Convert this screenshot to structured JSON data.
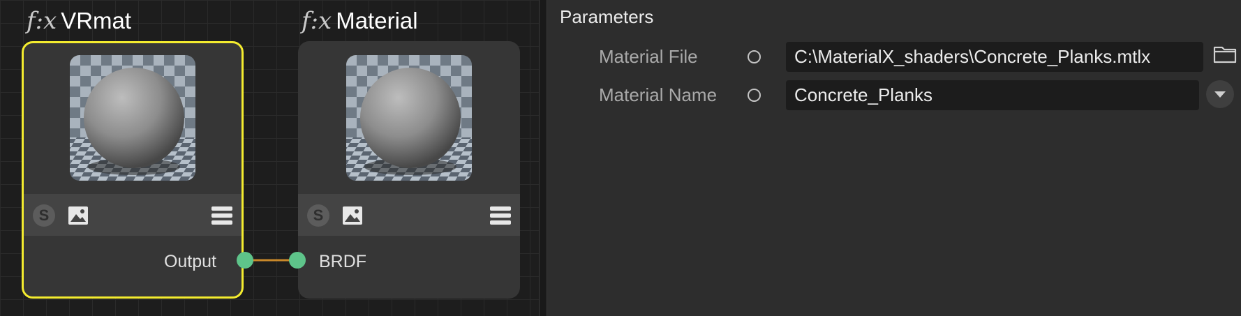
{
  "graph": {
    "nodes": [
      {
        "fx": "f:x",
        "title": "VRmat",
        "output_label": "Output"
      },
      {
        "fx": "f:x",
        "title": "Material",
        "input_label": "BRDF"
      }
    ],
    "toolbar_icons": [
      "shader-s-icon",
      "image-icon",
      "menu-icon"
    ],
    "port_color": "#5ec48a",
    "wire_color": "#c8882a",
    "selection_color": "#f4ec2f"
  },
  "params": {
    "title": "Parameters",
    "rows": [
      {
        "label": "Material File",
        "value": "C:\\MaterialX_shaders\\Concrete_Planks.mtlx",
        "action_icon": "folder-icon"
      },
      {
        "label": "Material Name",
        "value": "Concrete_Planks",
        "action_icon": "dropdown-arrow-icon"
      }
    ]
  }
}
